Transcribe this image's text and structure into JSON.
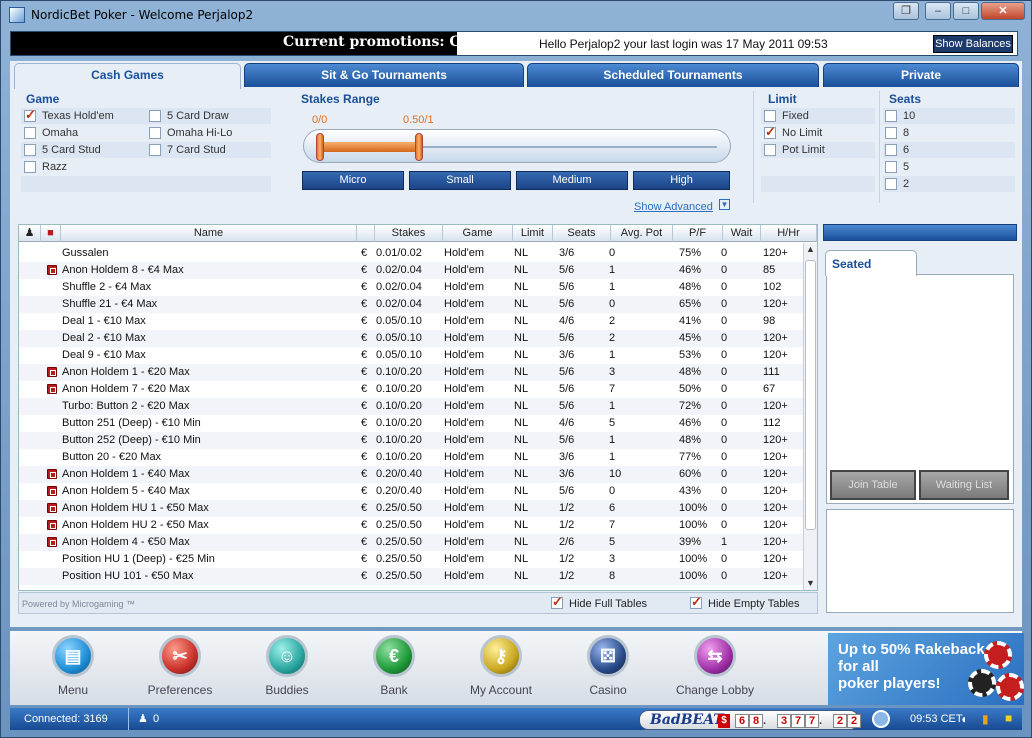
{
  "window": {
    "title": "NordicBet Poker - Welcome Perjalop2",
    "controls": [
      "minimize",
      "maximize",
      "close"
    ]
  },
  "topbar": {
    "promo": "Current promotions: Cash +",
    "hello": "Hello Perjalop2 your last login was 17 May 2011 09:53",
    "balances_button": "Show Balances"
  },
  "tabs": [
    "Cash Games",
    "Sit & Go Tournaments",
    "Scheduled Tournaments",
    "Private"
  ],
  "filters": {
    "game_label": "Game",
    "games": [
      {
        "label": "Texas Hold'em",
        "checked": true
      },
      {
        "label": "5 Card Draw",
        "checked": false
      },
      {
        "label": "Omaha",
        "checked": false
      },
      {
        "label": "Omaha Hi-Lo",
        "checked": false
      },
      {
        "label": "5 Card Stud",
        "checked": false
      },
      {
        "label": "7 Card Stud",
        "checked": false
      },
      {
        "label": "Razz",
        "checked": false
      }
    ],
    "stakes_label": "Stakes Range",
    "stakes_min": "0/0",
    "stakes_max": "0.50/1",
    "stakes_buttons": [
      "Micro",
      "Small",
      "Medium",
      "High"
    ],
    "show_advanced": "Show Advanced",
    "limit_label": "Limit",
    "limits": [
      {
        "label": "Fixed",
        "checked": false
      },
      {
        "label": "No Limit",
        "checked": true
      },
      {
        "label": "Pot Limit",
        "checked": false
      }
    ],
    "seats_label": "Seats",
    "seats": [
      {
        "label": "10",
        "checked": false
      },
      {
        "label": "8",
        "checked": false
      },
      {
        "label": "6",
        "checked": false
      },
      {
        "label": "5",
        "checked": false
      },
      {
        "label": "2",
        "checked": false
      }
    ]
  },
  "table": {
    "headers": [
      "Name",
      "Stakes",
      "Game",
      "Limit",
      "Seats",
      "Avg. Pot",
      "P/F",
      "Wait",
      "H/Hr"
    ],
    "rows": [
      {
        "lock": false,
        "name": "Gussalen",
        "cur": "€",
        "stakes": "0.01/0.02",
        "game": "Hold'em",
        "limit": "NL",
        "seats": "3/6",
        "avgpot": "0",
        "pf": "75%",
        "wait": "0",
        "hhr": "120+"
      },
      {
        "lock": true,
        "name": "Anon Holdem 8 - €4 Max",
        "cur": "€",
        "stakes": "0.02/0.04",
        "game": "Hold'em",
        "limit": "NL",
        "seats": "5/6",
        "avgpot": "1",
        "pf": "46%",
        "wait": "0",
        "hhr": "85"
      },
      {
        "lock": false,
        "name": "Shuffle 2 - €4 Max",
        "cur": "€",
        "stakes": "0.02/0.04",
        "game": "Hold'em",
        "limit": "NL",
        "seats": "5/6",
        "avgpot": "1",
        "pf": "48%",
        "wait": "0",
        "hhr": "102"
      },
      {
        "lock": false,
        "name": "Shuffle 21 - €4 Max",
        "cur": "€",
        "stakes": "0.02/0.04",
        "game": "Hold'em",
        "limit": "NL",
        "seats": "5/6",
        "avgpot": "0",
        "pf": "65%",
        "wait": "0",
        "hhr": "120+"
      },
      {
        "lock": false,
        "name": "Deal 1 - €10 Max",
        "cur": "€",
        "stakes": "0.05/0.10",
        "game": "Hold'em",
        "limit": "NL",
        "seats": "4/6",
        "avgpot": "2",
        "pf": "41%",
        "wait": "0",
        "hhr": "98"
      },
      {
        "lock": false,
        "name": "Deal 2 - €10 Max",
        "cur": "€",
        "stakes": "0.05/0.10",
        "game": "Hold'em",
        "limit": "NL",
        "seats": "5/6",
        "avgpot": "2",
        "pf": "45%",
        "wait": "0",
        "hhr": "120+"
      },
      {
        "lock": false,
        "name": "Deal 9 - €10 Max",
        "cur": "€",
        "stakes": "0.05/0.10",
        "game": "Hold'em",
        "limit": "NL",
        "seats": "3/6",
        "avgpot": "1",
        "pf": "53%",
        "wait": "0",
        "hhr": "120+"
      },
      {
        "lock": true,
        "name": "Anon Holdem 1 - €20 Max",
        "cur": "€",
        "stakes": "0.10/0.20",
        "game": "Hold'em",
        "limit": "NL",
        "seats": "5/6",
        "avgpot": "3",
        "pf": "48%",
        "wait": "0",
        "hhr": "111"
      },
      {
        "lock": true,
        "name": "Anon Holdem 7 - €20 Max",
        "cur": "€",
        "stakes": "0.10/0.20",
        "game": "Hold'em",
        "limit": "NL",
        "seats": "5/6",
        "avgpot": "7",
        "pf": "50%",
        "wait": "0",
        "hhr": "67"
      },
      {
        "lock": false,
        "name": "Turbo: Button 2 - €20 Max",
        "cur": "€",
        "stakes": "0.10/0.20",
        "game": "Hold'em",
        "limit": "NL",
        "seats": "5/6",
        "avgpot": "1",
        "pf": "72%",
        "wait": "0",
        "hhr": "120+"
      },
      {
        "lock": false,
        "name": "Button 251 (Deep) - €10 Min",
        "cur": "€",
        "stakes": "0.10/0.20",
        "game": "Hold'em",
        "limit": "NL",
        "seats": "4/6",
        "avgpot": "5",
        "pf": "46%",
        "wait": "0",
        "hhr": "112"
      },
      {
        "lock": false,
        "name": "Button 252 (Deep) - €10 Min",
        "cur": "€",
        "stakes": "0.10/0.20",
        "game": "Hold'em",
        "limit": "NL",
        "seats": "5/6",
        "avgpot": "1",
        "pf": "48%",
        "wait": "0",
        "hhr": "120+"
      },
      {
        "lock": false,
        "name": "Button 20 - €20 Max",
        "cur": "€",
        "stakes": "0.10/0.20",
        "game": "Hold'em",
        "limit": "NL",
        "seats": "3/6",
        "avgpot": "1",
        "pf": "77%",
        "wait": "0",
        "hhr": "120+"
      },
      {
        "lock": true,
        "name": "Anon Holdem 1 - €40 Max",
        "cur": "€",
        "stakes": "0.20/0.40",
        "game": "Hold'em",
        "limit": "NL",
        "seats": "3/6",
        "avgpot": "10",
        "pf": "60%",
        "wait": "0",
        "hhr": "120+"
      },
      {
        "lock": true,
        "name": "Anon Holdem 5 - €40 Max",
        "cur": "€",
        "stakes": "0.20/0.40",
        "game": "Hold'em",
        "limit": "NL",
        "seats": "5/6",
        "avgpot": "0",
        "pf": "43%",
        "wait": "0",
        "hhr": "120+"
      },
      {
        "lock": true,
        "name": "Anon Holdem HU 1 - €50 Max",
        "cur": "€",
        "stakes": "0.25/0.50",
        "game": "Hold'em",
        "limit": "NL",
        "seats": "1/2",
        "avgpot": "6",
        "pf": "100%",
        "wait": "0",
        "hhr": "120+"
      },
      {
        "lock": true,
        "name": "Anon Holdem HU 2 - €50 Max",
        "cur": "€",
        "stakes": "0.25/0.50",
        "game": "Hold'em",
        "limit": "NL",
        "seats": "1/2",
        "avgpot": "7",
        "pf": "100%",
        "wait": "0",
        "hhr": "120+"
      },
      {
        "lock": true,
        "name": "Anon Holdem 4 - €50 Max",
        "cur": "€",
        "stakes": "0.25/0.50",
        "game": "Hold'em",
        "limit": "NL",
        "seats": "2/6",
        "avgpot": "5",
        "pf": "39%",
        "wait": "1",
        "hhr": "120+"
      },
      {
        "lock": false,
        "name": "Position HU 1 (Deep) - €25 Min",
        "cur": "€",
        "stakes": "0.25/0.50",
        "game": "Hold'em",
        "limit": "NL",
        "seats": "1/2",
        "avgpot": "3",
        "pf": "100%",
        "wait": "0",
        "hhr": "120+"
      },
      {
        "lock": false,
        "name": "Position HU 101 - €50 Max",
        "cur": "€",
        "stakes": "0.25/0.50",
        "game": "Hold'em",
        "limit": "NL",
        "seats": "1/2",
        "avgpot": "8",
        "pf": "100%",
        "wait": "0",
        "hhr": "120+"
      }
    ]
  },
  "table_footer": {
    "powered": "Powered by Microgaming ™",
    "hide_full": "Hide Full Tables",
    "hide_empty": "Hide Empty Tables"
  },
  "right_panel": {
    "seated_tab": "Seated",
    "join_button": "Join Table",
    "waiting_button": "Waiting List"
  },
  "bottom_nav": [
    {
      "label": "Menu",
      "icon": "menu-icon",
      "color": "#1e8fd6"
    },
    {
      "label": "Preferences",
      "icon": "preferences-icon",
      "color": "#c8322c"
    },
    {
      "label": "Buddies",
      "icon": "buddies-icon",
      "color": "#2aa6a0"
    },
    {
      "label": "Bank",
      "icon": "bank-icon",
      "color": "#1f9a3a"
    },
    {
      "label": "My Account",
      "icon": "key-icon",
      "color": "#c9a820"
    },
    {
      "label": "Casino",
      "icon": "dice-icon",
      "color": "#2a4c8a"
    },
    {
      "label": "Change Lobby",
      "icon": "change-lobby-icon",
      "color": "#a030a8"
    }
  ],
  "ad": {
    "line1": "Up to 50% Rakeback",
    "line2": "for all",
    "line3": "poker players!"
  },
  "status": {
    "connected": "Connected: 3169",
    "users": "0",
    "badbeat_logo": "BadBEAT",
    "badbeat_currency": "$",
    "badbeat_digits": [
      "6",
      "8",
      ".",
      "3",
      "7",
      "7",
      ".",
      "2",
      "2"
    ],
    "time": "09:53 CET"
  },
  "colors": {
    "accent": "#1a4f99",
    "brand_dark": "#184a92"
  }
}
